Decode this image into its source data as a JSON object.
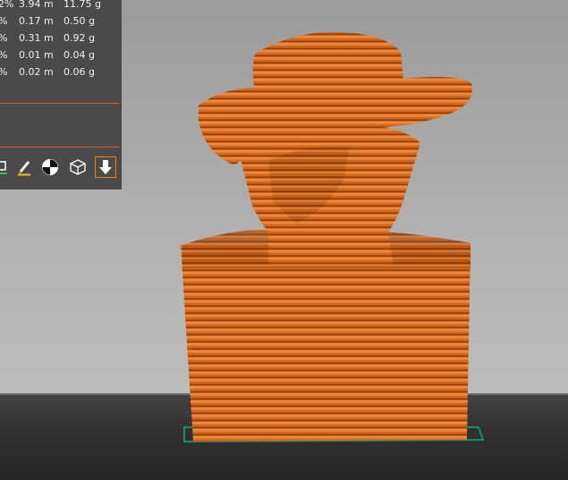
{
  "slice_stats": {
    "rows": [
      {
        "percent": "2%",
        "length": "3.94 m",
        "weight": "11.75 g"
      },
      {
        "percent": "%",
        "length": "0.17 m",
        "weight": "0.50 g"
      },
      {
        "percent": "%",
        "length": "0.31 m",
        "weight": "0.92 g"
      },
      {
        "percent": "%",
        "length": "0.01 m",
        "weight": "0.04 g"
      },
      {
        "percent": "%",
        "length": "0.02 m",
        "weight": "0.06 g"
      }
    ]
  },
  "toolbar": {
    "tools": [
      {
        "icon": "color-painting-icon",
        "active": false
      },
      {
        "icon": "paint-brush-icon",
        "active": false
      },
      {
        "icon": "seam-painting-icon",
        "active": false
      },
      {
        "icon": "cube-wireframe-icon",
        "active": false
      },
      {
        "icon": "arrow-down-icon",
        "active": true
      }
    ]
  },
  "colors": {
    "accent": "#e0621c",
    "model": "#d2691e",
    "panel": "#4a4a4a",
    "floor": "#2a2a2a"
  }
}
